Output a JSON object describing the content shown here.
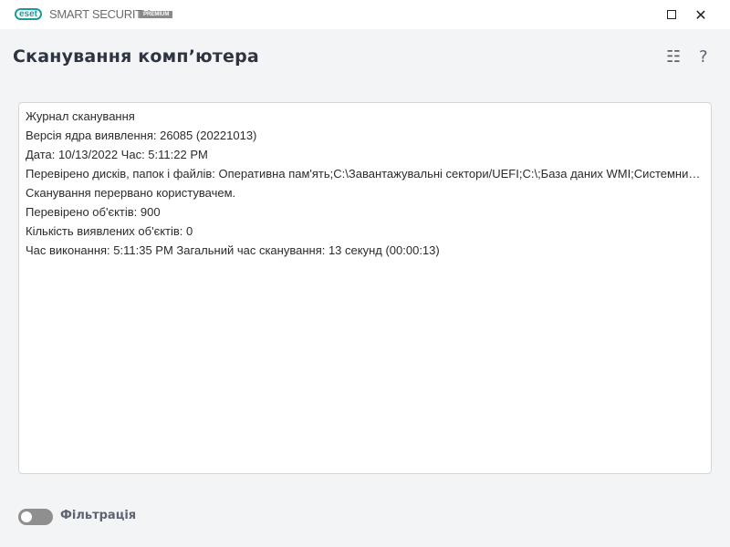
{
  "app": {
    "brand": "eset",
    "product": "SMART SECURITY",
    "edition": "PREMIUM"
  },
  "window": {
    "maximize": "maximize-icon",
    "close": "close-icon"
  },
  "header": {
    "title": "Сканування комп’ютера",
    "list_icon": "☷",
    "help_icon": "?"
  },
  "log": {
    "lines": [
      "Журнал сканування",
      "Версія ядра виявлення: 26085 (20221013)",
      "Дата: 10/13/2022  Час: 5:11:22 PM",
      "Перевірено дисків, папок і файлів: Оперативна пам'ять;C:\\Завантажувальні сектори/UEFI;C:\\;База даних WMI;Системний...",
      "Сканування перервано користувачем.",
      "Перевірено об'єктів: 900",
      "Кількість виявлених об'єктів: 0",
      "Час виконання: 5:11:35 PM  Загальний час сканування: 13 секунд (00:00:13)"
    ]
  },
  "filter": {
    "label": "Фільтрація",
    "enabled": false
  }
}
